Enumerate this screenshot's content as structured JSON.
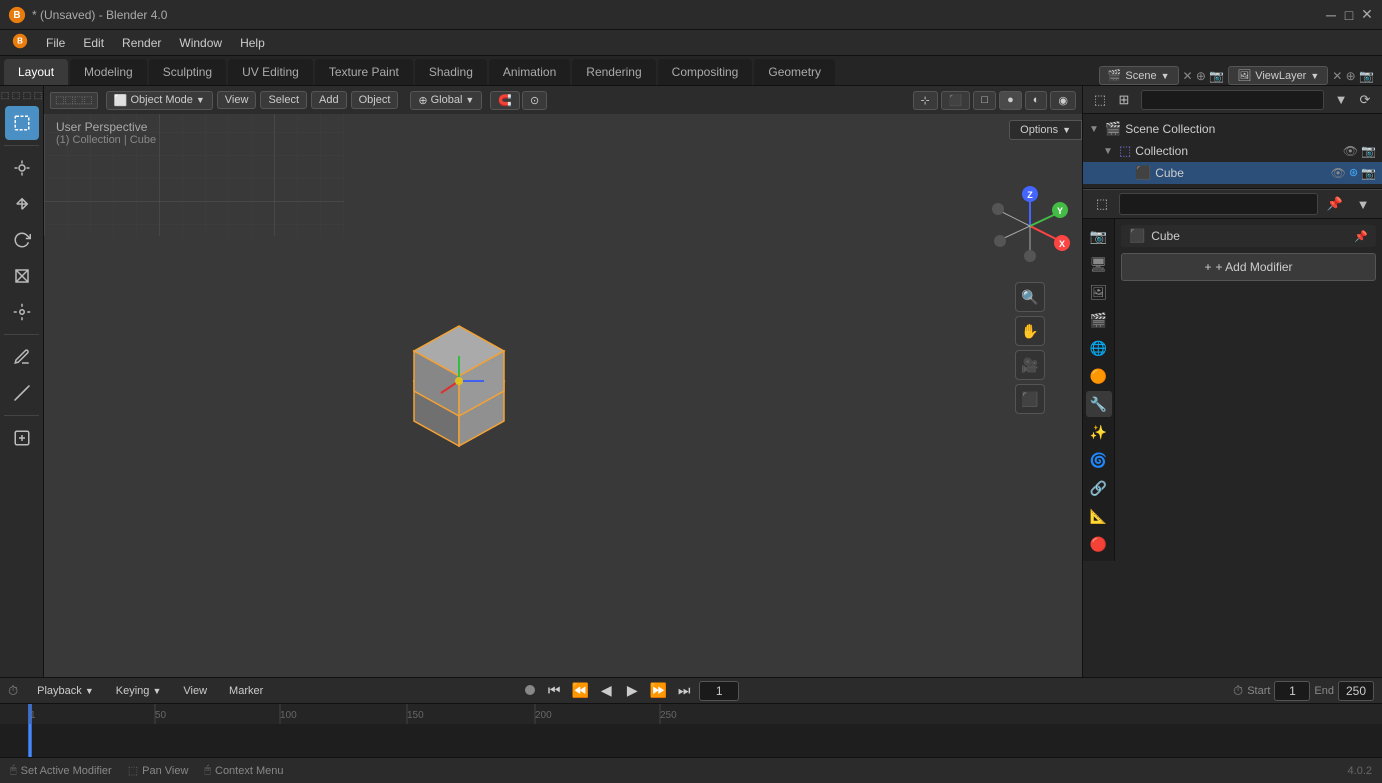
{
  "titleBar": {
    "appName": "* (Unsaved) - Blender 4.0",
    "minimize": "─",
    "maximize": "□",
    "close": "✕"
  },
  "menuBar": {
    "items": [
      "Blender",
      "File",
      "Edit",
      "Render",
      "Window",
      "Help"
    ]
  },
  "workspaceTabs": {
    "tabs": [
      "Layout",
      "Modeling",
      "Sculpting",
      "UV Editing",
      "Texture Paint",
      "Shading",
      "Animation",
      "Rendering",
      "Compositing",
      "Geometry"
    ],
    "activeTab": "Layout"
  },
  "viewport": {
    "modeLabel": "Object Mode",
    "viewLabel": "View",
    "selectLabel": "Select",
    "addLabel": "Add",
    "objectLabel": "Object",
    "transformOrient": "Global",
    "perspLabel": "User Perspective",
    "collectionInfo": "(1) Collection | Cube",
    "optionsBtn": "Options"
  },
  "gizmo": {
    "axes": [
      "X",
      "Y",
      "Z"
    ]
  },
  "outliner": {
    "searchPlaceholder": "",
    "sceneCollection": "Scene Collection",
    "collection": "Collection",
    "cube": "Cube",
    "sceneName": "Scene",
    "viewLayerName": "ViewLayer"
  },
  "properties": {
    "objectName": "Cube",
    "addModifierLabel": "+ Add Modifier",
    "searchPlaceholder": ""
  },
  "timeline": {
    "playbackLabel": "Playback",
    "keyingLabel": "Keying",
    "viewLabel": "View",
    "markerLabel": "Marker",
    "currentFrame": "1",
    "startFrame": "1",
    "endFrame": "250",
    "startLabel": "Start",
    "endLabel": "End",
    "rulerTicks": [
      "1",
      "50",
      "100",
      "150",
      "200",
      "250"
    ]
  },
  "statusBar": {
    "setActiveModifier": "Set Active Modifier",
    "panView": "Pan View",
    "contextMenu": "Context Menu",
    "version": "4.0.2"
  },
  "leftTools": {
    "tools": [
      {
        "name": "select-box",
        "icon": "⬚"
      },
      {
        "name": "move",
        "icon": "✛"
      },
      {
        "name": "rotate",
        "icon": "↻"
      },
      {
        "name": "scale",
        "icon": "⊠"
      },
      {
        "name": "transform",
        "icon": "⊹"
      },
      {
        "name": "annotate",
        "icon": "✏"
      },
      {
        "name": "measure",
        "icon": "📏"
      },
      {
        "name": "add-cube",
        "icon": "⬛"
      }
    ]
  }
}
